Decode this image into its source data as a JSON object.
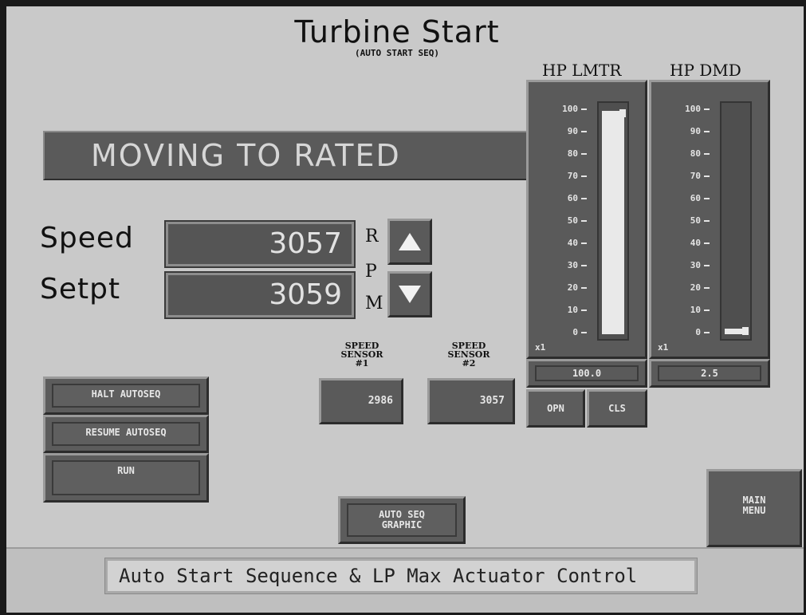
{
  "header": {
    "title": "Turbine Start",
    "subtitle": "(AUTO START SEQ)"
  },
  "status": {
    "message": "MOVING TO RATED"
  },
  "speed": {
    "speed_label": "Speed",
    "speed_value": "3057",
    "setpoint_label": "Setpt",
    "setpoint_value": "3059",
    "units": [
      "R",
      "P",
      "M"
    ],
    "raise_icon": "triangle-up-icon",
    "lower_icon": "triangle-down-icon"
  },
  "sequence_buttons": {
    "halt": "HALT AUTOSEQ",
    "resume": "RESUME AUTOSEQ",
    "run": "RUN"
  },
  "sensors": [
    {
      "label": [
        "SPEED",
        "SENSOR",
        "#1"
      ],
      "value": "2986"
    },
    {
      "label": [
        "SPEED",
        "SENSOR",
        "#2"
      ],
      "value": "3057"
    }
  ],
  "gauges": {
    "scale_labels": [
      "100",
      "90",
      "80",
      "70",
      "60",
      "50",
      "40",
      "30",
      "20",
      "10",
      "0"
    ],
    "hp_lmtr": {
      "title": "HP LMTR",
      "multiplier": "x1",
      "readout": "100.0",
      "level_percent": 100
    },
    "hp_dmd": {
      "title": "HP DMD",
      "multiplier": "x1",
      "readout": "2.5",
      "level_percent": 2.5
    }
  },
  "valve_buttons": {
    "open": "OPN",
    "close": "CLS"
  },
  "nav_buttons": {
    "auto_seq_graphic": [
      "AUTO SEQ",
      "GRAPHIC"
    ],
    "main_menu": [
      "MAIN",
      "MENU"
    ]
  },
  "footer": {
    "description": "Auto Start Sequence & LP Max Actuator Control"
  },
  "colors": {
    "screen_background": "#c9c9c9",
    "panel": "#5a5a5a",
    "text_light": "#e6e6e6"
  }
}
